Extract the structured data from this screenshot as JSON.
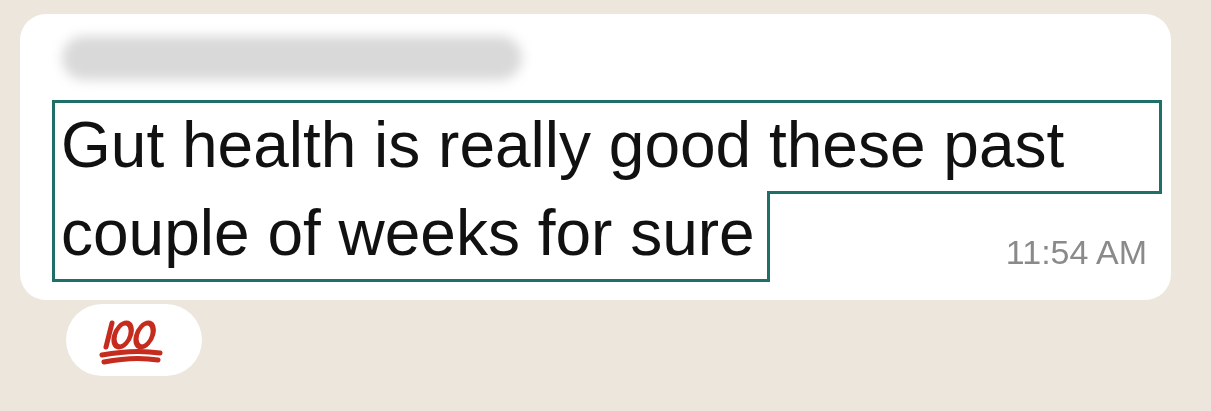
{
  "message": {
    "sender_hidden": true,
    "lines": [
      "Gut health is really good these past",
      "couple of weeks for sure"
    ],
    "highlighted": true,
    "time": "11:54 AM"
  },
  "reaction": {
    "kind": "hundred"
  }
}
